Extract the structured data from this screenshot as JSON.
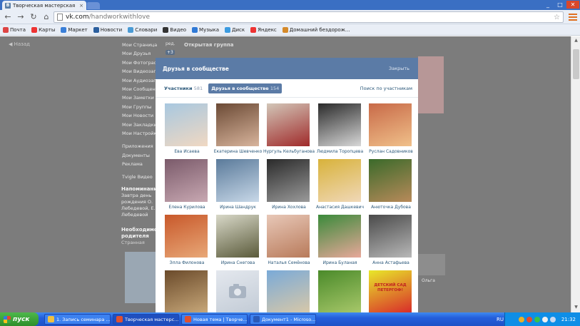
{
  "browser": {
    "tab_title": "Творческая мастерская \"Т...",
    "tab_favicon": "В",
    "tab_close": "×",
    "url_host": "vk.com",
    "url_path": "/handworkwithlove",
    "win_minimize": "_",
    "win_maximize": "□",
    "win_close": "✕"
  },
  "bookmarks": [
    {
      "label": "Почта",
      "color": "#d44"
    },
    {
      "label": "Карты",
      "color": "#e33"
    },
    {
      "label": "Маркет",
      "color": "#3a7fd8"
    },
    {
      "label": "Новости",
      "color": "#2b5f9e"
    },
    {
      "label": "Словари",
      "color": "#4a9ad4"
    },
    {
      "label": "Видео",
      "color": "#333"
    },
    {
      "label": "Музыка",
      "color": "#2f79d6"
    },
    {
      "label": "Диск",
      "color": "#3b9be0"
    },
    {
      "label": "Яндекс",
      "color": "#e33"
    },
    {
      "label": "Домашний бездорож...",
      "color": "#d58a2a"
    }
  ],
  "page": {
    "back_link": "◀ Назад",
    "left_menu": [
      "Мои Страница",
      "Мои Друзья",
      "Мои Фотографии",
      "Мои Видеозаписи",
      "Мои Аудиозаписи",
      "Мои Сообщения",
      "Мои Заметки",
      "Мои Группы",
      "Мои Новости",
      "Мои Закладки",
      "Мои Настройки"
    ],
    "left_menu_2": [
      "Приложения",
      "Документы",
      "Реклама"
    ],
    "left_menu_3": [
      "Tvigle Видео"
    ],
    "counter_first": "ред.",
    "counter_badge": "+3",
    "group_title": "Открытая группа",
    "reminder_title": "Напоминание",
    "reminder_text": "Завтра день рождения О. Лебедевой, Е. Лебедевой",
    "need_title": "Необходимо родителя",
    "need_sub": "Странная",
    "right_label": "Ольга"
  },
  "modal": {
    "title": "Друзья в сообществе",
    "close": "Закрыть",
    "tab_members_label": "Участники",
    "tab_members_count": "581",
    "tab_friends_label": "Друзья в сообществе",
    "tab_friends_count": "154",
    "search_link": "Поиск по участникам",
    "people": [
      {
        "name": "Ева Исаева",
        "colors": [
          "#a8c8e0",
          "#f0d8c2"
        ]
      },
      {
        "name": "Екатерина Шевченко",
        "colors": [
          "#6b4a35",
          "#d8b49c"
        ]
      },
      {
        "name": "Нургуль Кельбуганова",
        "colors": [
          "#d2c6b8",
          "#a02a2a"
        ]
      },
      {
        "name": "Людмила Торопцева",
        "colors": [
          "#2a2a2a",
          "#d8d8d8"
        ]
      },
      {
        "name": "Руслан Садовников",
        "colors": [
          "#c86a48",
          "#f0c08a"
        ]
      },
      {
        "name": "Елена Курилова",
        "colors": [
          "#7a5a6a",
          "#c8a8b2"
        ]
      },
      {
        "name": "Ирина Шандрук",
        "colors": [
          "#5a7a9a",
          "#c8d8e8"
        ]
      },
      {
        "name": "Ирина Хохлова",
        "colors": [
          "#2a2a2a",
          "#9a9a9a"
        ]
      },
      {
        "name": "Анастасия Дашкевич",
        "colors": [
          "#d8b23a",
          "#f0d8b8"
        ]
      },
      {
        "name": "Анюточка Дубова",
        "colors": [
          "#3a6a2a",
          "#b88a5a"
        ]
      },
      {
        "name": "Элла Филонова",
        "colors": [
          "#c8582a",
          "#e8a878"
        ]
      },
      {
        "name": "Ирина Снегова",
        "colors": [
          "#d8d8c8",
          "#5a5a3a"
        ]
      },
      {
        "name": "Наталья Семёнова",
        "colors": [
          "#e8c8b8",
          "#b87a5a"
        ]
      },
      {
        "name": "Ирина Буланая",
        "colors": [
          "#3a8a3a",
          "#e8a89a"
        ]
      },
      {
        "name": "Анна Астафьева",
        "colors": [
          "#4a4a4a",
          "#b8b8b8"
        ]
      },
      {
        "name": "",
        "colors": [
          "#6a4a2a",
          "#c8a87a"
        ]
      },
      {
        "name": "",
        "colors": [
          "#e4e8ee",
          "#c2cbd6"
        ]
      },
      {
        "name": "",
        "colors": [
          "#7aaad8",
          "#d8c8a8"
        ]
      },
      {
        "name": "",
        "colors": [
          "#4a8a2a",
          "#a8c86a"
        ]
      },
      {
        "name": "",
        "colors": [
          "#e8e82a",
          "#d82a2a"
        ]
      }
    ],
    "ad_text": "ДЕТСКИЙ САД ПЕТЕРГОФ!"
  },
  "taskbar": {
    "start_label": "пуск",
    "items": [
      {
        "label": "1. Запись семинара ...",
        "icon_color": "#f0c040",
        "active": false
      },
      {
        "label": "Творческая мастерс...",
        "icon_color": "#e05030",
        "active": true
      },
      {
        "label": "Новая тема | Творче...",
        "icon_color": "#e05030",
        "active": false
      },
      {
        "label": "Документ1 - Microso...",
        "icon_color": "#2a5ab8",
        "active": false
      }
    ],
    "lang": "RU",
    "clock": "21:32"
  }
}
